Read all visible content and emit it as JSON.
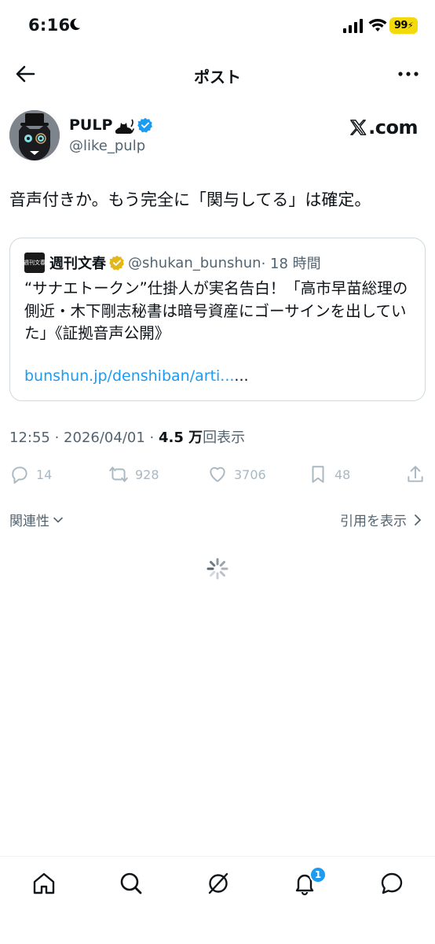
{
  "status_bar": {
    "time": "6:16",
    "battery": "99"
  },
  "header": {
    "title": "ポスト"
  },
  "author": {
    "name": "PULP",
    "handle": "@like_pulp"
  },
  "source_badge": {
    "label": ".com"
  },
  "post": {
    "text": "音声付きか。もう完全に「関与してる」は確定。"
  },
  "quote": {
    "logo_text": "週刊文春",
    "name": "週刊文春",
    "handle": "@shukan_bunshun",
    "time": "· 18 時間",
    "text": "“サナエトークン”仕掛人が実名告白！「高市早苗総理の側近・木下剛志秘書は暗号資産にゴーサインを出していた」《証拠音声公開》",
    "link": "bunshun.jp/denshiban/arti...",
    "link_ellipsis": "..."
  },
  "meta": {
    "timestamp": "12:55 · 2026/04/01 · ",
    "views_count": "4.5 万",
    "views_label": "回表示"
  },
  "actions": {
    "replies": "14",
    "reposts": "928",
    "likes": "3706",
    "bookmarks": "48"
  },
  "sort": {
    "label": "関連性"
  },
  "quotes_link": {
    "label": "引用を表示"
  },
  "nav": {
    "notifications_badge": "1"
  },
  "colors": {
    "accent": "#1d9bf0",
    "muted": "#536471",
    "battery": "#f4d90b"
  }
}
